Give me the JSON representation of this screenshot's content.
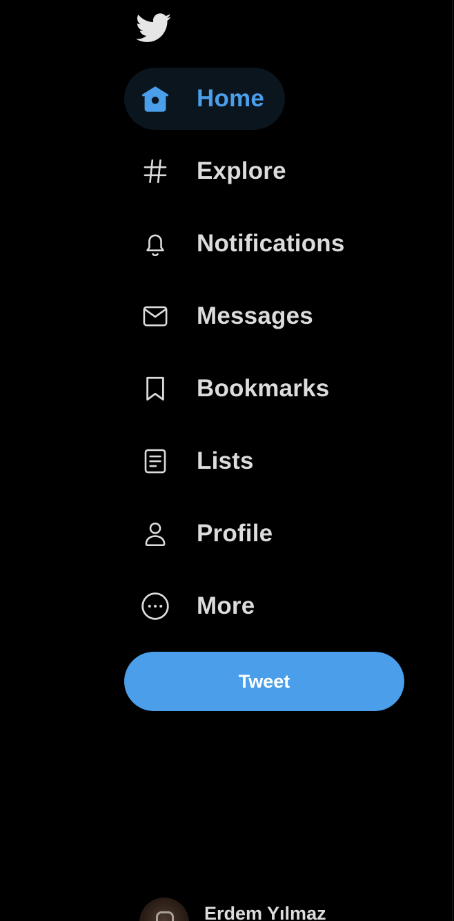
{
  "nav": {
    "items": [
      {
        "label": "Home",
        "icon": "home-icon",
        "active": true
      },
      {
        "label": "Explore",
        "icon": "hashtag-icon",
        "active": false
      },
      {
        "label": "Notifications",
        "icon": "bell-icon",
        "active": false
      },
      {
        "label": "Messages",
        "icon": "envelope-icon",
        "active": false
      },
      {
        "label": "Bookmarks",
        "icon": "bookmark-icon",
        "active": false
      },
      {
        "label": "Lists",
        "icon": "list-icon",
        "active": false
      },
      {
        "label": "Profile",
        "icon": "person-icon",
        "active": false
      },
      {
        "label": "More",
        "icon": "more-icon",
        "active": false
      }
    ]
  },
  "tweet_button": {
    "label": "Tweet"
  },
  "account": {
    "name": "Erdem Yılmaz"
  },
  "colors": {
    "accent": "#4a9eea",
    "background": "#000000",
    "text": "#dcdcdc",
    "active_bg": "#0b151e"
  }
}
